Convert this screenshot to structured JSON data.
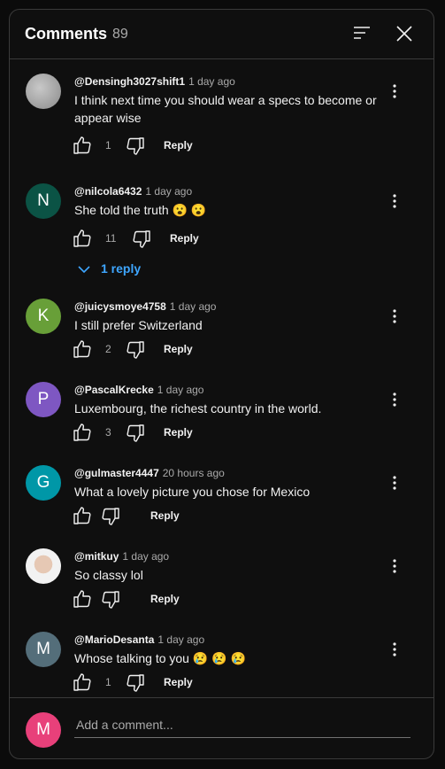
{
  "header": {
    "title": "Comments",
    "count": "89"
  },
  "comments": [
    {
      "author": "@Densingh3027shift1",
      "time": "1 day ago",
      "text": "I think next time you should wear a specs to become or appear wise",
      "likes": "1",
      "reply_label": "Reply",
      "avatar_color": "#9e9e9e"
    },
    {
      "author": "@nilcola6432",
      "time": "1 day ago",
      "text": "She told the truth 😮 😮",
      "likes": "11",
      "reply_label": "Reply",
      "avatar_letter": "N",
      "avatar_color": "#0b5345",
      "replies_label": "1 reply"
    },
    {
      "author": "@juicysmoye4758",
      "time": "1 day ago",
      "text": "I still prefer Switzerland",
      "likes": "2",
      "reply_label": "Reply",
      "avatar_letter": "K",
      "avatar_color": "#689f38"
    },
    {
      "author": "@PascalKrecke",
      "time": "1 day ago",
      "text": "Luxembourg, the richest country in the world.",
      "likes": "3",
      "reply_label": "Reply",
      "avatar_letter": "P",
      "avatar_color": "#7e57c2"
    },
    {
      "author": "@gulmaster4447",
      "time": "20 hours ago",
      "text": "What a lovely picture you chose for Mexico",
      "likes": "",
      "reply_label": "Reply",
      "avatar_letter": "G",
      "avatar_color": "#0097a7"
    },
    {
      "author": "@mitkuy",
      "time": "1 day ago",
      "text": "So classy lol",
      "likes": "",
      "reply_label": "Reply",
      "avatar_color": "#d9d9d9"
    },
    {
      "author": "@MarioDesanta",
      "time": "1 day ago",
      "text": "Whose talking to you 😢 😢 😢",
      "likes": "1",
      "reply_label": "Reply",
      "avatar_letter": "M",
      "avatar_color": "#546e7a"
    }
  ],
  "footer": {
    "avatar_letter": "M",
    "placeholder": "Add a comment..."
  },
  "icons": {
    "sort": "sort-icon",
    "close": "close-icon",
    "more": "more-vert-icon",
    "like": "thumb-up-icon",
    "dislike": "thumb-down-icon",
    "chevron": "chevron-down-icon"
  },
  "colors": {
    "link": "#3ea6ff",
    "divider": "#3a3a3a"
  }
}
